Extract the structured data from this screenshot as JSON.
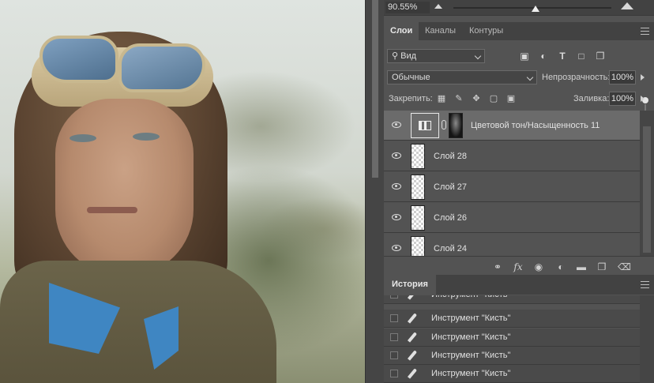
{
  "canvas": {
    "description_icon": "portrait-photo"
  },
  "navigator": {
    "zoom": "90.55%",
    "zoom_fraction": 0.52
  },
  "tabs": [
    {
      "label": "Слои",
      "active": true
    },
    {
      "label": "Каналы",
      "active": false
    },
    {
      "label": "Контуры",
      "active": false
    }
  ],
  "filter": {
    "kind_label": "Вид",
    "icons": [
      "image-filter-icon",
      "adjustment-filter-icon",
      "type-filter-icon",
      "shape-filter-icon",
      "smart-object-filter-icon"
    ]
  },
  "blend": {
    "mode": "Обычные",
    "opacity_label": "Непрозрачность:",
    "opacity": "100%"
  },
  "lock": {
    "label": "Закрепить:",
    "fill_label": "Заливка:",
    "fill": "100%"
  },
  "layers": [
    {
      "name": "Цветовой тон/Насыщенность 11",
      "type": "adjustment",
      "selected": true
    },
    {
      "name": "Слой 28",
      "type": "pixel",
      "selected": false
    },
    {
      "name": "Слой 27",
      "type": "pixel",
      "selected": false
    },
    {
      "name": "Слой 26",
      "type": "pixel",
      "selected": false
    },
    {
      "name": "Слой 24",
      "type": "pixel",
      "selected": false
    }
  ],
  "history": {
    "tab": "История",
    "items": [
      "Инструмент \"Кисть\"",
      "Инструмент \"Кисть\"",
      "Инструмент \"Кисть\"",
      "Инструмент \"Кисть\"",
      "Инструмент \"Кисть\""
    ]
  },
  "colors": {
    "panel": "#535353",
    "dark": "#424242",
    "selected": "#6b6b6b",
    "collar_blue": "#3f86c2"
  }
}
